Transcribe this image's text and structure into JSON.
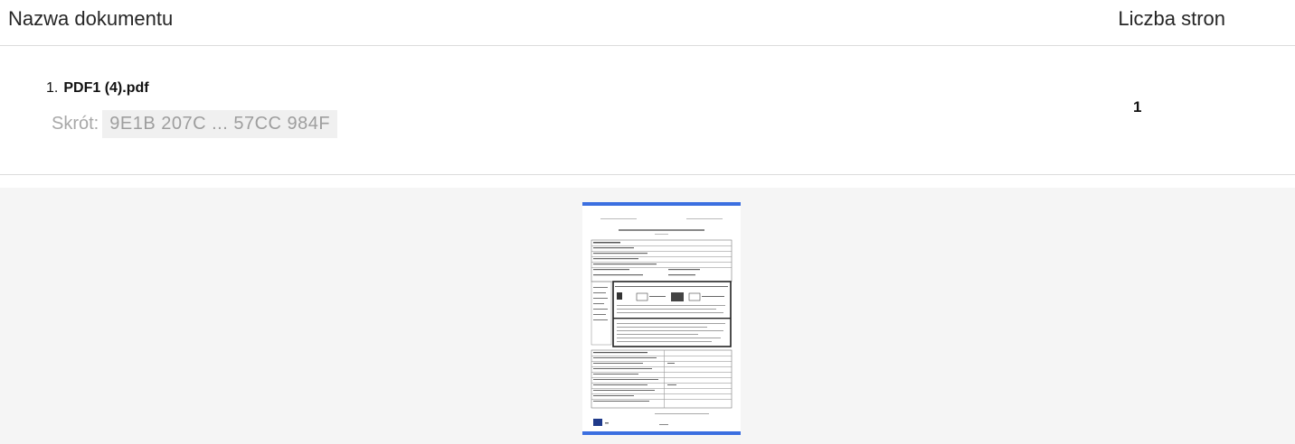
{
  "table": {
    "headers": {
      "name": "Nazwa dokumentu",
      "pages": "Liczba stron"
    },
    "documents": [
      {
        "index": "1.",
        "name": "PDF1 (4).pdf",
        "hash_label": "Skrót:",
        "hash_value": "9E1B 207C ... 57CC 984F",
        "page_count": "1"
      }
    ]
  },
  "colors": {
    "accent": "#3b6fe0",
    "divider": "#dcdcdc",
    "preview_background": "#f5f5f5",
    "muted_text": "#a8a8a8"
  }
}
